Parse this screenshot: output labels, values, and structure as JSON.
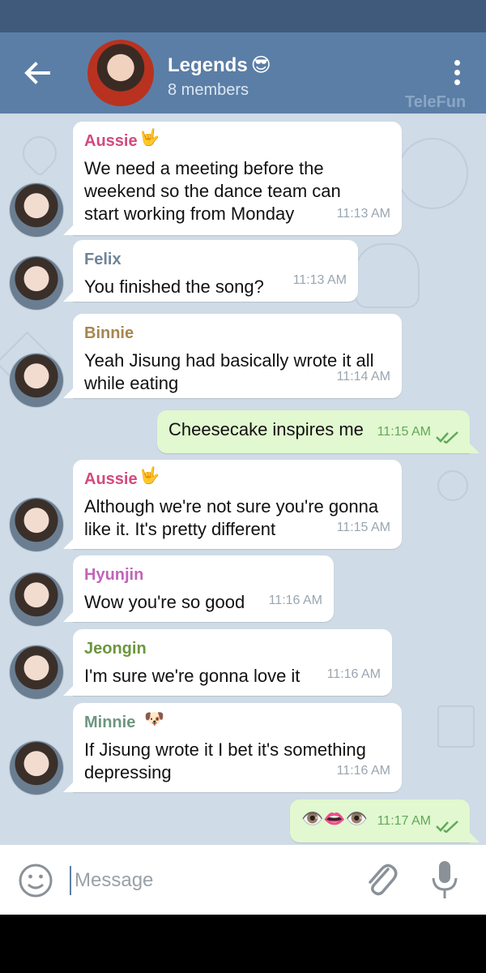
{
  "header": {
    "title": "Legends",
    "title_emoji": "😎",
    "subtitle": "8 members",
    "watermark": "TeleFun",
    "icons": [
      "back-arrow-icon",
      "group-avatar",
      "overflow-menu-icon"
    ]
  },
  "messages": [
    {
      "sender": "Aussie",
      "sender_emoji": "🤟",
      "text": "We need a meeting before the weekend so the dance team can start working from Monday",
      "time": "11:13 AM",
      "color": "#d24a7d"
    },
    {
      "sender": "Felix",
      "sender_emoji": "",
      "text": "You finished the song?",
      "time": "11:13 AM",
      "color": "#6f8597"
    },
    {
      "sender": "Binnie",
      "sender_emoji": "",
      "text": "Yeah Jisung had basically wrote it all while eating",
      "time": "11:14 AM",
      "color": "#a7864f"
    },
    {
      "sender": "",
      "sender_emoji": "",
      "text": "Cheesecake inspires me",
      "time": "11:15 AM",
      "status": "read"
    },
    {
      "sender": "Aussie",
      "sender_emoji": "🤟",
      "text": "Although we're not sure you're gonna like it. It's pretty different",
      "time": "11:15 AM",
      "color": "#d24a7d"
    },
    {
      "sender": "Hyunjin",
      "sender_emoji": "",
      "text": "Wow you're so good",
      "time": "11:16 AM",
      "color": "#c165b7"
    },
    {
      "sender": "Jeongin",
      "sender_emoji": "",
      "text": "I'm sure we're gonna love it",
      "time": "11:16 AM",
      "color": "#6b963f"
    },
    {
      "sender": "Minnie",
      "sender_emoji": "🐶",
      "text": "If Jisung wrote it I bet it's something depressing",
      "time": "11:16 AM",
      "color": "#6d9680"
    },
    {
      "sender": "",
      "sender_emoji": "",
      "text": "👁️👄👁️",
      "time": "11:17 AM",
      "status": "read"
    }
  ],
  "composer": {
    "placeholder": "Message",
    "icons": [
      "emoji-icon",
      "attach-icon",
      "microphone-icon"
    ]
  },
  "colors": {
    "header": "#5b7ea6",
    "statusbar": "#3f5a7b",
    "chat_background": "#cfdbe6",
    "outgoing_bubble": "#e2f8d0",
    "incoming_bubble": "#ffffff"
  }
}
